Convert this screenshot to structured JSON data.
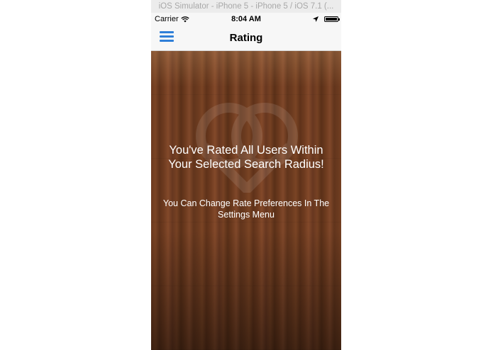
{
  "simulator": {
    "title": "iOS Simulator - iPhone 5 - iPhone 5 / iOS 7.1 (..."
  },
  "status_bar": {
    "carrier": "Carrier",
    "wifi_icon": "wifi-icon",
    "time": "8:04 AM",
    "location_icon": "location-arrow-icon",
    "battery_icon": "battery-icon",
    "battery_level": 1.0
  },
  "nav": {
    "menu_icon": "hamburger-menu-icon",
    "title": "Rating",
    "accent_color": "#2f7fd8"
  },
  "content": {
    "background": "wood-texture",
    "title": "You've Rated All Users Within Your Selected Search Radius!",
    "subtitle": "You Can Change Rate Preferences In The Settings Menu"
  }
}
